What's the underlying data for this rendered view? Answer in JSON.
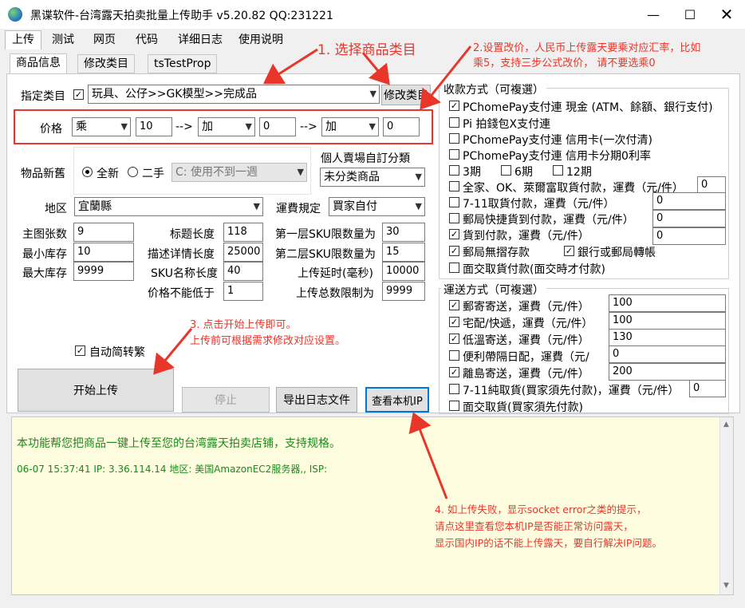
{
  "window": {
    "title": "黑谍软件-台湾露天拍卖批量上传助手 v5.20.82 QQ:231221",
    "controls": [
      "minimize-icon",
      "maximize-icon",
      "close-icon"
    ]
  },
  "menu_tabs": [
    "上传",
    "测试",
    "网页",
    "代码",
    "详细日志",
    "使用说明"
  ],
  "sub_tabs": [
    "商品信息",
    "修改类目",
    "tsTestProp"
  ],
  "category": {
    "label": "指定类目",
    "checked": true,
    "value": "玩具、公仔>>GK模型>>完成品",
    "modify_button": "修改类目"
  },
  "price": {
    "label": "价格",
    "op1": "乘",
    "val1": "10",
    "arrow1": "-->",
    "op2": "加",
    "val2": "0",
    "arrow2": "-->",
    "op3": "加",
    "val3": "0"
  },
  "condition": {
    "label": "物品新舊",
    "options": [
      "全新",
      "二手"
    ],
    "selected": "全新",
    "used_combo": "C: 使用不到一週"
  },
  "store_category": {
    "label": "個人賣場自訂分類",
    "value": "未分类商品"
  },
  "region": {
    "label": "地区",
    "value": "宜蘭縣"
  },
  "shipping_rule": {
    "label": "運費規定",
    "value": "買家自付"
  },
  "fields_left": [
    {
      "label": "主图张数",
      "value": "9"
    },
    {
      "label": "最小库存",
      "value": "10"
    },
    {
      "label": "最大库存",
      "value": "9999"
    }
  ],
  "fields_mid": [
    {
      "label": "标题长度",
      "value": "118"
    },
    {
      "label": "描述详情长度",
      "value": "25000"
    },
    {
      "label": "SKU名称长度",
      "value": "40"
    },
    {
      "label": "价格不能低于",
      "value": "1"
    }
  ],
  "fields_right": [
    {
      "label": "第一层SKU限数量为",
      "value": "30"
    },
    {
      "label": "第二层SKU限数量为",
      "value": "15"
    },
    {
      "label": "上传延时(毫秒)",
      "value": "10000"
    },
    {
      "label": "上传总数限制为",
      "value": "9999"
    }
  ],
  "auto_convert": {
    "label": "自动简转繁",
    "checked": true
  },
  "buttons": {
    "start": "开始上传",
    "stop": "停止",
    "export_log": "导出日志文件",
    "check_ip": "查看本机IP"
  },
  "payment": {
    "title": "收款方式（可複選）",
    "items": [
      {
        "label": "PChomePay支付連 現金 (ATM、餘額、銀行支付)",
        "checked": true
      },
      {
        "label": "Pi 拍錢包X支付連",
        "checked": false
      },
      {
        "label": "PChomePay支付連 信用卡(一次付清)",
        "checked": false
      },
      {
        "label": "PChomePay支付連 信用卡分期0利率",
        "checked": false
      }
    ],
    "installments": [
      {
        "label": "3期",
        "checked": false
      },
      {
        "label": "6期",
        "checked": false
      },
      {
        "label": "12期",
        "checked": false
      }
    ],
    "cod_items": [
      {
        "label": "全家、OK、萊爾富取貨付款，運費（元/件）",
        "checked": false,
        "value": "0"
      },
      {
        "label": "7-11取貨付款，運費（元/件）",
        "checked": false,
        "value": "0"
      },
      {
        "label": "郵局快捷貨到付款，運費（元/件）",
        "checked": false,
        "value": "0"
      },
      {
        "label": "貨到付款，運費（元/件）",
        "checked": true,
        "value": "0"
      }
    ],
    "post_no_fold": {
      "label": "郵局無摺存款",
      "checked": true
    },
    "bank_transfer": {
      "label": "銀行或郵局轉帳",
      "checked": true
    },
    "face_to_face": {
      "label": "面交取貨付款(面交時才付款)",
      "checked": false
    }
  },
  "shipping": {
    "title": "運送方式（可複選）",
    "items": [
      {
        "label": "郵寄寄送，運費（元/件）",
        "checked": true,
        "value": "100"
      },
      {
        "label": "宅配/快遞，運費（元/件）",
        "checked": true,
        "value": "100"
      },
      {
        "label": "低溫寄送，運費（元/件）",
        "checked": true,
        "value": "130"
      },
      {
        "label": "便利帶隔日配，運費（元/",
        "checked": false,
        "value": "0"
      },
      {
        "label": "離島寄送，運費（元/件）",
        "checked": true,
        "value": "200"
      },
      {
        "label": "7-11純取貨(買家須先付款)，運費（元/件）",
        "checked": false,
        "value": "0"
      },
      {
        "label": "面交取貨(買家須先付款)",
        "checked": false
      }
    ]
  },
  "annotations": {
    "step1": "1. 选择商品类目",
    "step2_line1": "2.设置改价，人民币上传露天要乘对应汇率，比如",
    "step2_line2": "乘5，支持三步公式改价， 请不要选乘0",
    "step3_line1": "3. 点击开始上传即可。",
    "step3_line2": "上传前可根据需求修改对应设置。",
    "step4_line1": "4. 如上传失败，显示socket error之类的提示，",
    "step4_line2": "请点这里查看您本机IP是否能正常访问露天，",
    "step4_line3": "显示国内IP的话不能上传露天，要自行解决IP问题。"
  },
  "log": {
    "line1": "本功能帮您把商品一键上传至您的台湾露天拍卖店铺，支持规格。",
    "line2": "06-07 15:37:41  IP: 3.36.114.14  地区: 美国AmazonEC2服务器,, ISP:"
  },
  "colors": {
    "annotation": "#e8362a",
    "log_bg": "#fffde0",
    "log_text": "#1a8a1a"
  }
}
